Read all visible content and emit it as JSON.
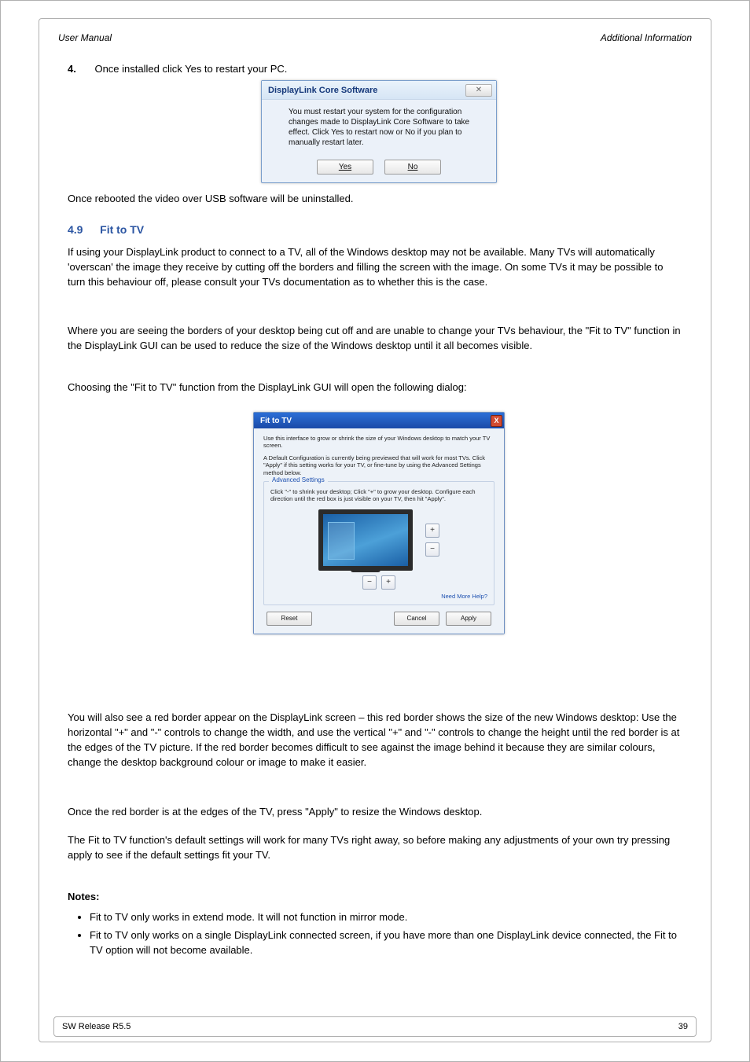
{
  "header": {
    "left": "User Manual",
    "right": "Additional Information"
  },
  "step4": {
    "num": "4.",
    "text": "Once installed click Yes to restart your PC."
  },
  "restartDialog": {
    "title": "DisplayLink Core Software",
    "closeGlyph": "✕",
    "line1": "You must restart your system for the configuration",
    "line2": "changes made to DisplayLink Core Software to take",
    "line3": "effect. Click Yes to restart now or No if you plan to",
    "line4": "manually restart later.",
    "yes": "Yes",
    "no": "No"
  },
  "afterRestart": "Once rebooted the video over USB software will be uninstalled.",
  "section": {
    "num": "4.9",
    "title": "Fit to TV",
    "p1": "If using your DisplayLink product to connect to a TV, all of the Windows desktop may not be available. Many TVs will automatically 'overscan' the image they receive by cutting off the borders and filling the screen with the image. On some TVs it may be possible to turn this behaviour off, please consult your TVs documentation as to whether this is the case.",
    "p2_a": "Where you are seeing the borders of your desktop being cut off and are unable to change your TVs behaviour, the \"Fit to TV\" function in the DisplayLink GUI can be used to reduce the size of the Windows desktop until it all becomes visible.",
    "p2_b": "Choosing the \"Fit to TV\" function from the DisplayLink GUI will open the following dialog:"
  },
  "fitToTv": {
    "title": "Fit to TV",
    "closeGlyph": "X",
    "intro1": "Use this interface to grow or shrink the size of your Windows desktop to match your TV screen.",
    "intro2": "A Default Configuration is currently being previewed that will work for most TVs. Click \"Apply\" if this setting works for your TV, or fine-tune by using the Advanced Settings method below.",
    "advTitle": "Advanced Settings",
    "advText": "Click \"-\" to shrink your desktop; Click \"+\" to grow your desktop. Configure each direction until the red box is just visible on your TV, then hit \"Apply\".",
    "plus": "+",
    "minus": "−",
    "needMoreHelp": "Need More Help?",
    "reset": "Reset",
    "cancel": "Cancel",
    "apply": "Apply"
  },
  "belowFtv": {
    "p1": "You will also see a red border appear on the DisplayLink screen – this red border shows the size of the new Windows desktop: Use the horizontal \"+\" and \"-\" controls to change the width, and use the vertical \"+\" and \"-\" controls to change the height until the red border is at the edges of the TV picture. If the red border becomes difficult to see against the image behind it because they are similar colours, change the desktop background colour or image to make it easier.",
    "p2": "Once the red border is at the edges of the TV, press \"Apply\" to resize the Windows desktop.",
    "p3": "The Fit to TV function's default settings will work for many TVs right away, so before making any adjustments of your own try pressing apply to see if the default settings fit your TV.",
    "notesHdr": "Notes:",
    "bullet1": "Fit to TV only works in extend mode. It will not function in mirror mode.",
    "bullet2": "Fit to TV only works on a single DisplayLink connected screen, if you have more than one DisplayLink device connected, the Fit to TV option will not become available."
  },
  "footer": {
    "left": "SW Release R5.5",
    "right": "39"
  }
}
